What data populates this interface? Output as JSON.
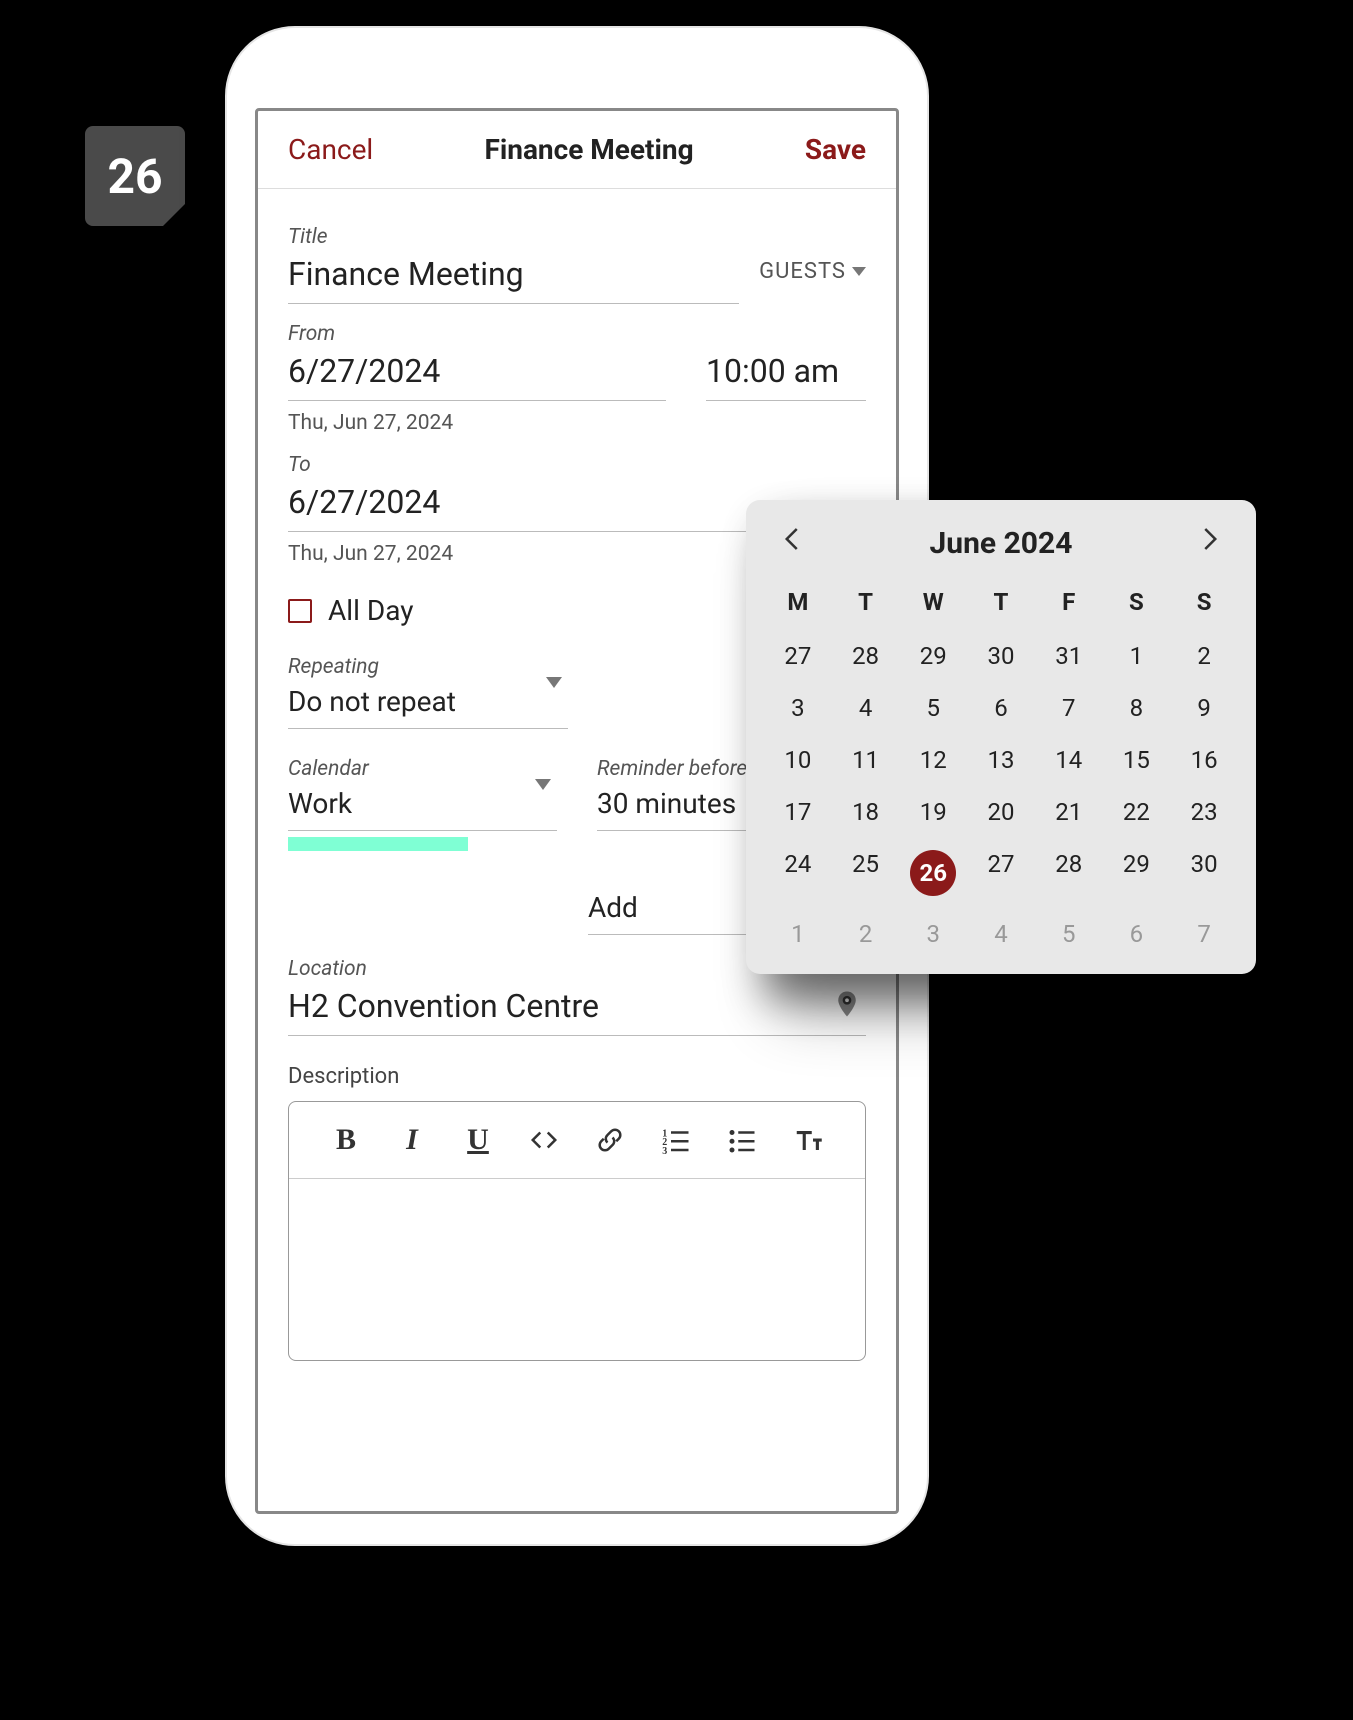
{
  "app_icon": {
    "label": "26"
  },
  "header": {
    "cancel": "Cancel",
    "title": "Finance Meeting",
    "save": "Save"
  },
  "fields": {
    "title_label": "Title",
    "title_value": "Finance Meeting",
    "guests_label": "GUESTS",
    "from_label": "From",
    "from_date": "6/27/2024",
    "from_time": "10:00 am",
    "from_helper": "Thu, Jun 27, 2024",
    "to_label": "To",
    "to_date": "6/27/2024",
    "to_helper": "Thu, Jun 27, 2024",
    "allday_label": "All Day",
    "repeating_label": "Repeating",
    "repeating_value": "Do not repeat",
    "calendar_label": "Calendar",
    "calendar_value": "Work",
    "reminder_label": "Reminder before",
    "reminder_value": "30 minutes",
    "add_label": "Add",
    "location_label": "Location",
    "location_value": "H2 Convention Centre",
    "description_label": "Description"
  },
  "datepicker": {
    "month_label": "June 2024",
    "dow": [
      "M",
      "T",
      "W",
      "T",
      "F",
      "S",
      "S"
    ],
    "selected": "26",
    "leading_days": [
      "27",
      "28",
      "29",
      "30",
      "31"
    ],
    "month_days": [
      "1",
      "2",
      "3",
      "4",
      "5",
      "6",
      "7",
      "8",
      "9",
      "10",
      "11",
      "12",
      "13",
      "14",
      "15",
      "16",
      "17",
      "18",
      "19",
      "20",
      "21",
      "22",
      "23",
      "24",
      "25",
      "26",
      "27",
      "28",
      "29",
      "30"
    ],
    "trailing_days": [
      "1",
      "2",
      "3",
      "4",
      "5",
      "6",
      "7"
    ]
  },
  "rte_icons": [
    "bold",
    "italic",
    "underline",
    "code",
    "link",
    "olist",
    "ulist",
    "textsize"
  ]
}
